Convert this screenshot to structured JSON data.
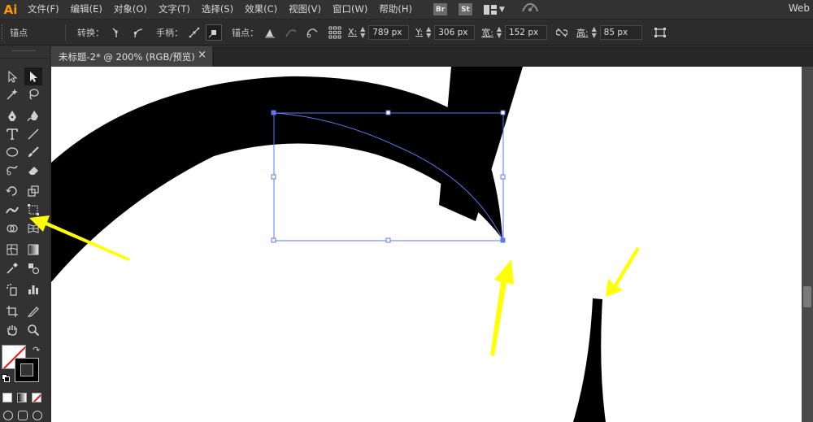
{
  "app": {
    "logo": "Ai",
    "workspace": "Web"
  },
  "menu": [
    "文件(F)",
    "编辑(E)",
    "对象(O)",
    "文字(T)",
    "选择(S)",
    "效果(C)",
    "视图(V)",
    "窗口(W)",
    "帮助(H)"
  ],
  "app_switch": {
    "bridge": "Br",
    "stock": "St"
  },
  "control_bar": {
    "selection_label": "锚点",
    "convert_label": "转换：",
    "handles_label": "手柄：",
    "anchors_label": "锚点：",
    "x_label": "X:",
    "x_value": "789 px",
    "y_label": "Y:",
    "y_value": "306 px",
    "w_label": "宽:",
    "w_value": "152 px",
    "h_label": "高:",
    "h_value": "85 px"
  },
  "document": {
    "tab_title": "未标题-2* @ 200% (RGB/预览)",
    "close_glyph": "×"
  },
  "colors": {
    "ui_bg": "#323232",
    "control_bg": "#2c2c2c",
    "canvas": "#ffffff",
    "shape": "#000000",
    "selection": "#4a6cf7",
    "arrow": "#ffff00",
    "logo": "#ff9a00"
  }
}
